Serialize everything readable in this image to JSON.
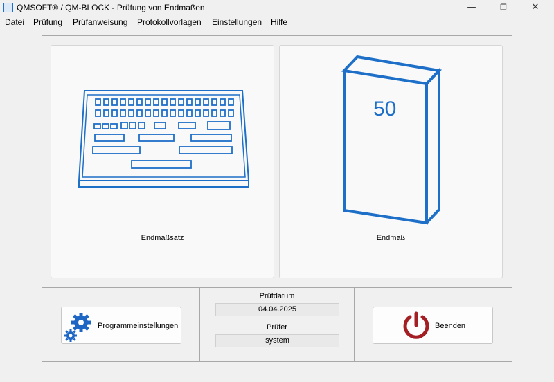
{
  "window": {
    "title": "QMSOFT® / QM-BLOCK - Prüfung von Endmaßen",
    "minimize_glyph": "—",
    "maximize_glyph": "❐",
    "close_glyph": "✕"
  },
  "menu": {
    "items": [
      {
        "label": "Datei"
      },
      {
        "label": "Prüfung"
      },
      {
        "label": "Prüfanweisung"
      },
      {
        "label": "Protokollvorlagen"
      },
      {
        "label": "Einstellungen"
      },
      {
        "label": "Hilfe"
      }
    ]
  },
  "tiles": {
    "set": {
      "label": "Endmaßsatz",
      "icon": "gauge-block-set-icon"
    },
    "single": {
      "label": "Endmaß",
      "icon": "gauge-block-icon",
      "block_value": "50"
    }
  },
  "footer": {
    "settings_button": {
      "label_pre": "Programm",
      "label_mnemonic": "e",
      "label_post": "instellungen",
      "icon": "gears-icon"
    },
    "test_date_label": "Prüfdatum",
    "test_date_value": "04.04.2025",
    "tester_label": "Prüfer",
    "tester_value": "system",
    "exit_button": {
      "label_mnemonic": "B",
      "label_post": "eenden",
      "icon": "power-icon"
    }
  },
  "colors": {
    "icon_blue": "#1e6fc8",
    "power_red": "#a41f23",
    "gear_blue": "#1d66c4"
  }
}
